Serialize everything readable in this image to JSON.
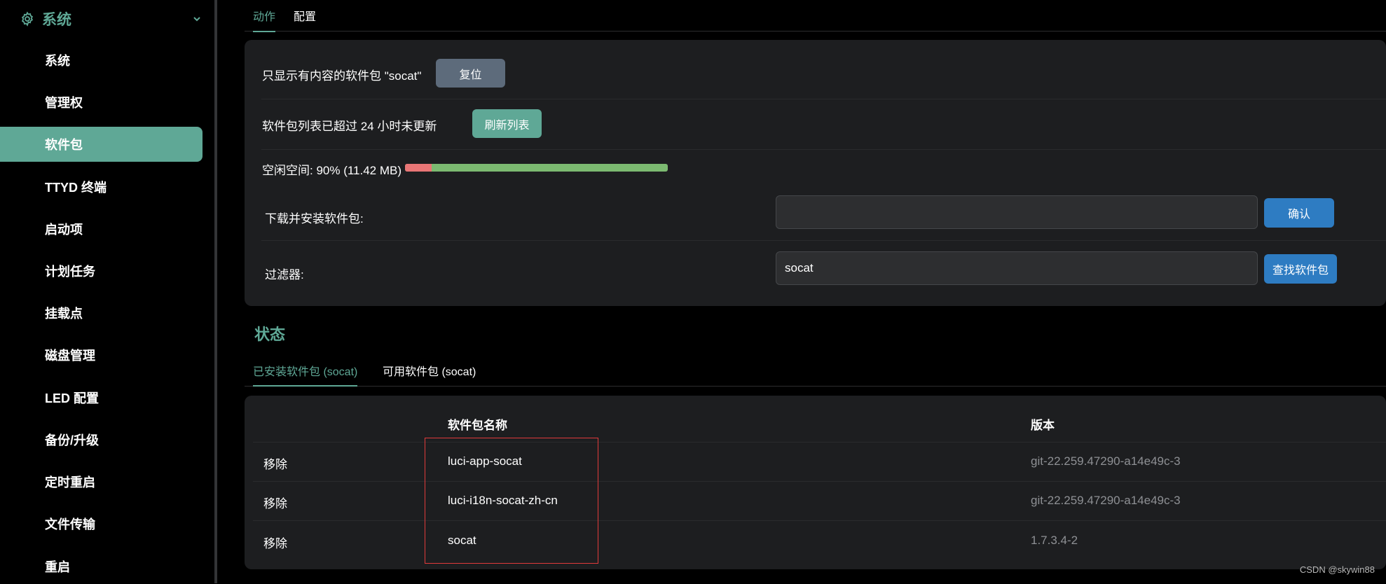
{
  "sidebar": {
    "group_label": "系统",
    "items": [
      {
        "label": "系统"
      },
      {
        "label": "管理权"
      },
      {
        "label": "软件包",
        "active": true
      },
      {
        "label": "TTYD 终端"
      },
      {
        "label": "启动项"
      },
      {
        "label": "计划任务"
      },
      {
        "label": "挂载点"
      },
      {
        "label": "磁盘管理"
      },
      {
        "label": "LED 配置"
      },
      {
        "label": "备份/升级"
      },
      {
        "label": "定时重启"
      },
      {
        "label": "文件传输"
      },
      {
        "label": "重启"
      }
    ]
  },
  "top_tabs": [
    {
      "label": "动作",
      "active": true
    },
    {
      "label": "配置",
      "active": false
    }
  ],
  "actions": {
    "filter_notice": "只显示有内容的软件包 \"socat\"",
    "reset_label": "复位",
    "list_notice": "软件包列表已超过 24 小时未更新",
    "refresh_label": "刷新列表",
    "free_space_text": "空闲空间: 90% (11.42 MB)",
    "free_space_used_fraction": 0.1,
    "download_label": "下载并安装软件包:",
    "download_value": "",
    "confirm_label": "确认",
    "filter_label": "过滤器:",
    "filter_value": "socat",
    "find_label": "查找软件包"
  },
  "status": {
    "title": "状态",
    "tabs": [
      {
        "label": "已安装软件包 (socat)",
        "active": true
      },
      {
        "label": "可用软件包 (socat)",
        "active": false
      }
    ],
    "table": {
      "headers": {
        "name": "软件包名称",
        "version": "版本"
      },
      "rows": [
        {
          "action": "移除",
          "name": "luci-app-socat",
          "version": "git-22.259.47290-a14e49c-3"
        },
        {
          "action": "移除",
          "name": "luci-i18n-socat-zh-cn",
          "version": "git-22.259.47290-a14e49c-3"
        },
        {
          "action": "移除",
          "name": "socat",
          "version": "1.7.3.4-2"
        }
      ]
    }
  },
  "watermark": "CSDN @skywin88",
  "colors": {
    "accent": "#5fa896",
    "button_grey": "#5d6b7b",
    "button_blue": "#2e7cc2",
    "bar_free": "#7cba71",
    "bar_used": "#e97676",
    "highlight": "#e13b3b"
  },
  "icons": {
    "group": "gear-icon",
    "expand": "chevron-down-icon"
  }
}
